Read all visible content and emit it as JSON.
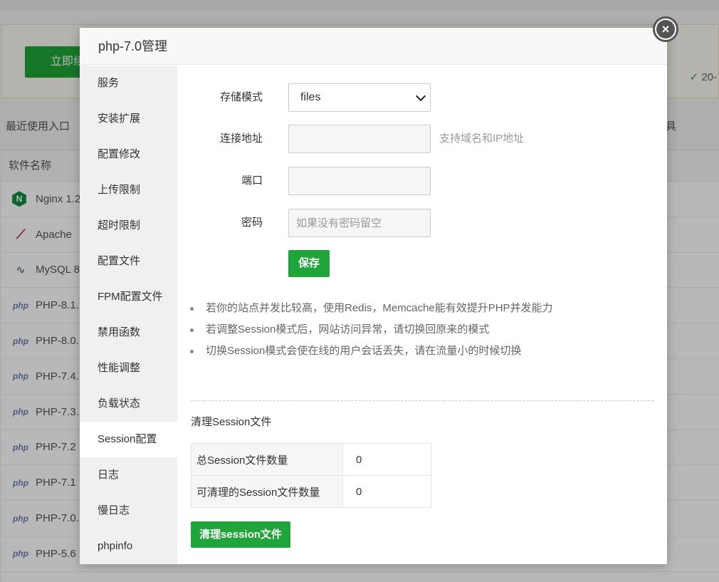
{
  "background": {
    "banner_button": "立即续",
    "banner_right": "20-",
    "recent_entry": "最近使用入口",
    "tools_label": "具",
    "table_header": "软件名称",
    "rows": [
      {
        "name": "Nginx 1.2",
        "icon": "nginx-icon"
      },
      {
        "name": "Apache",
        "icon": "apache-icon"
      },
      {
        "name": "MySQL 8",
        "icon": "mysql-icon"
      },
      {
        "name": "PHP-8.1.",
        "icon": "php-icon"
      },
      {
        "name": "PHP-8.0.",
        "icon": "php-icon"
      },
      {
        "name": "PHP-7.4.",
        "icon": "php-icon"
      },
      {
        "name": "PHP-7.3.",
        "icon": "php-icon"
      },
      {
        "name": "PHP-7.2",
        "icon": "php-icon"
      },
      {
        "name": "PHP-7.1",
        "icon": "php-icon"
      },
      {
        "name": "PHP-7.0.",
        "icon": "php-icon"
      },
      {
        "name": "PHP-5.6",
        "icon": "php-icon"
      }
    ],
    "php_badge": "php"
  },
  "modal": {
    "title": "php-7.0管理",
    "close_glyph": "×",
    "sidebar": [
      {
        "label": "服务"
      },
      {
        "label": "安装扩展"
      },
      {
        "label": "配置修改"
      },
      {
        "label": "上传限制"
      },
      {
        "label": "超时限制"
      },
      {
        "label": "配置文件"
      },
      {
        "label": "FPM配置文件"
      },
      {
        "label": "禁用函数"
      },
      {
        "label": "性能调整"
      },
      {
        "label": "负载状态"
      },
      {
        "label": "Session配置",
        "active": true
      },
      {
        "label": "日志"
      },
      {
        "label": "慢日志"
      },
      {
        "label": "phpinfo"
      }
    ],
    "form": {
      "storage_label": "存储模式",
      "storage_value": "files",
      "address_label": "连接地址",
      "address_value": "",
      "address_hint": "支持域名和IP地址",
      "port_label": "端口",
      "port_value": "",
      "password_label": "密码",
      "password_placeholder": "如果没有密码留空",
      "save_label": "保存"
    },
    "tips": [
      "若你的站点并发比较高，使用Redis，Memcache能有效提升PHP并发能力",
      "若调整Session模式后，网站访问异常，请切换回原来的模式",
      "切换Session模式会使在线的用户会话丢失，请在流量小的时候切换"
    ],
    "clean": {
      "title": "清理Session文件",
      "total_label": "总Session文件数量",
      "total_value": "0",
      "cleanable_label": "可清理的Session文件数量",
      "cleanable_value": "0",
      "button_label": "清理session文件"
    }
  },
  "colors": {
    "accent": "#20a53a",
    "sidebar_bg": "#f0f0f0"
  }
}
